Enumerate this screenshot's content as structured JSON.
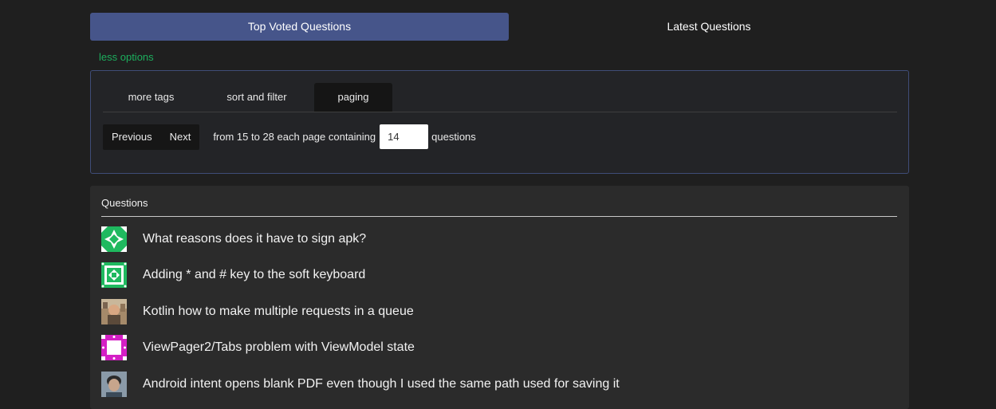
{
  "top_tabs": {
    "top_voted": "Top Voted Questions",
    "latest": "Latest Questions"
  },
  "less_options": "less options",
  "options": {
    "tabs": [
      "more tags",
      "sort and filter",
      "paging"
    ],
    "active_tab": "paging",
    "paging": {
      "previous": "Previous",
      "next": "Next",
      "range_text": "from 15 to 28 each page containing",
      "page_size": "14",
      "suffix": "questions"
    }
  },
  "questions": {
    "header": "Questions",
    "items": [
      {
        "title": "What reasons does it have to sign apk?",
        "avatar": "green-identicon"
      },
      {
        "title": "Adding * and # key to the soft keyboard",
        "avatar": "green-pattern-identicon"
      },
      {
        "title": "Kotlin how to make multiple requests in a queue",
        "avatar": "photo-avatar"
      },
      {
        "title": "ViewPager2/Tabs problem with ViewModel state",
        "avatar": "magenta-identicon"
      },
      {
        "title": "Android intent opens blank PDF even though I used the same path used for saving it",
        "avatar": "person-photo-avatar"
      }
    ]
  },
  "colors": {
    "active_tab": "#46558a",
    "link_green": "#1cae5d",
    "panel_border": "#3f4d78",
    "identicon_green": "#1fb95f",
    "identicon_magenta": "#d41fc5"
  }
}
